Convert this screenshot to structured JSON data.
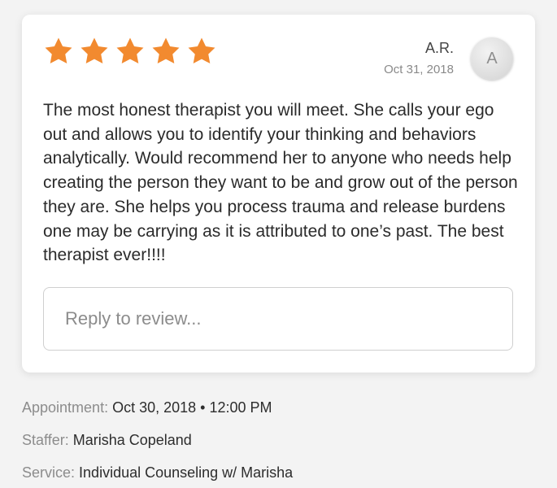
{
  "review": {
    "rating": 5,
    "rating_max": 5,
    "star_color": "#f28a2f",
    "reviewer_name": "A.R.",
    "avatar_initial": "A",
    "date": "Oct 31, 2018",
    "text": "The most honest therapist you will meet. She calls your ego out and allows you to identify your thinking and behaviors analytically. Would recommend her to anyone who needs help creating the person they want to be and grow out of the person they are. She helps you process trauma and release burdens one may be carrying as it is attributed to one’s past. The best therapist ever!!!!",
    "reply": {
      "placeholder": "Reply to review...",
      "value": ""
    }
  },
  "details": {
    "appointment_label": "Appointment:",
    "appointment_value": "Oct 30, 2018 • 12:00 PM",
    "staffer_label": "Staffer:",
    "staffer_value": "Marisha Copeland",
    "service_label": "Service:",
    "service_value": "Individual Counseling w/ Marisha"
  }
}
